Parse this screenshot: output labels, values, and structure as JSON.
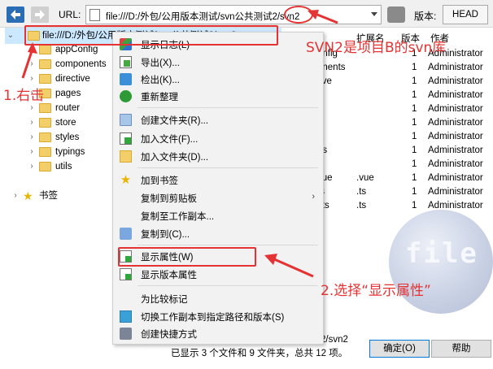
{
  "toolbar": {
    "url_label": "URL:",
    "url_value": "file:///D:/外包/公用版本测试/svn公共测试2/svn2",
    "version_label": "版本:",
    "version_value": "HEAD"
  },
  "tree": {
    "root_label": "file:///D:/外包/公用版本测试/svn公共测试2/svn2",
    "folders": [
      "appConfig",
      "components",
      "directive",
      "pages",
      "router",
      "store",
      "styles",
      "typings",
      "utils"
    ],
    "bookmarks_label": "书签"
  },
  "columns": {
    "headers": [
      "扩展名",
      "版本",
      "作者"
    ],
    "rows": [
      {
        "name": "onfig",
        "ext": "",
        "rev": "1",
        "author": "Administrator"
      },
      {
        "name": "onents",
        "ext": "",
        "rev": "1",
        "author": "Administrator"
      },
      {
        "name": "tive",
        "ext": "",
        "rev": "1",
        "author": "Administrator"
      },
      {
        "name": "",
        "ext": "",
        "rev": "1",
        "author": "Administrator"
      },
      {
        "name": "r",
        "ext": "",
        "rev": "1",
        "author": "Administrator"
      },
      {
        "name": "",
        "ext": "",
        "rev": "1",
        "author": "Administrator"
      },
      {
        "name": "s",
        "ext": "",
        "rev": "1",
        "author": "Administrator"
      },
      {
        "name": "gs",
        "ext": "",
        "rev": "1",
        "author": "Administrator"
      },
      {
        "name": "",
        "ext": "",
        "rev": "1",
        "author": "Administrator"
      },
      {
        "name": "vue",
        "ext": ".vue",
        "rev": "1",
        "author": "Administrator"
      },
      {
        "name": "ts",
        "ext": ".ts",
        "rev": "1",
        "author": "Administrator"
      },
      {
        "name": "l.ts",
        "ext": ".ts",
        "rev": "1",
        "author": "Administrator"
      }
    ]
  },
  "watermark_text": "file",
  "context_menu": {
    "items": [
      "显示日志(L)",
      "导出(X)...",
      "检出(K)...",
      "重新整理",
      "创建文件夹(R)...",
      "加入文件(F)...",
      "加入文件夹(D)...",
      "加到书签",
      "复制到剪贴板",
      "复制至工作副本...",
      "复制到(C)...",
      "显示属性(W)",
      "显示版本属性",
      "为比较标记",
      "切换工作副本到指定路径和版本(S)",
      "创建快捷方式"
    ]
  },
  "status": {
    "path_tail": "2/svn2",
    "summary": "已显示 3 个文件和 9 文件夹，总共 12 项。"
  },
  "buttons": {
    "ok": "确定(O)",
    "help": "帮助"
  },
  "annotations": {
    "step1": "1.右击",
    "step2": "2.选择“显示属性”",
    "svn_note": "SVN2是项目B的svn库",
    "highlight_color": "#e53333"
  }
}
